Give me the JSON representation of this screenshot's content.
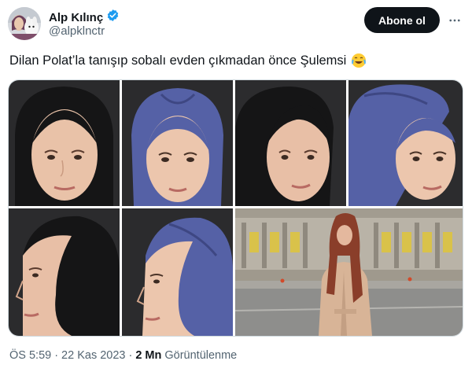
{
  "author": {
    "display_name": "Alp Kılınç",
    "handle": "@alpklnctr",
    "verified_icon": "verified-badge-icon",
    "avatar_icon": "avatar"
  },
  "actions": {
    "follow_label": "Abone ol",
    "more_icon": "more-horizontal-icon"
  },
  "tweet": {
    "text": "Dilan Polat’la tanışıp sobalı evden çıkmadan önce Şulemsi",
    "emoji": "😂",
    "emoji_icon": "laughing-tears-emoji-icon"
  },
  "media": {
    "photos": [
      {
        "icon": "portrait-black-headscarf-front"
      },
      {
        "icon": "portrait-blue-headscarf-front"
      },
      {
        "icon": "portrait-black-headscarf-three-quarter"
      },
      {
        "icon": "portrait-blue-headscarf-three-quarter"
      },
      {
        "icon": "portrait-black-headscarf-profile"
      },
      {
        "icon": "portrait-blue-headscarf-profile"
      },
      {
        "icon": "woman-in-beige-suit-in-front-of-building"
      }
    ]
  },
  "meta": {
    "time": "ÖS 5:59",
    "separator1": "·",
    "date": "22 Kas 2023",
    "separator2": "·",
    "views_count": "2 Mn",
    "views_label": "Görüntülenme"
  },
  "colors": {
    "text": "#0f1419",
    "secondary": "#536471",
    "verified": "#1d9bf0",
    "follow_bg": "#0f1419",
    "scarf_black": "#1b1b1d",
    "scarf_blue": "#5561a6",
    "skin": "#e8bfa6",
    "suit": "#d8b497"
  }
}
